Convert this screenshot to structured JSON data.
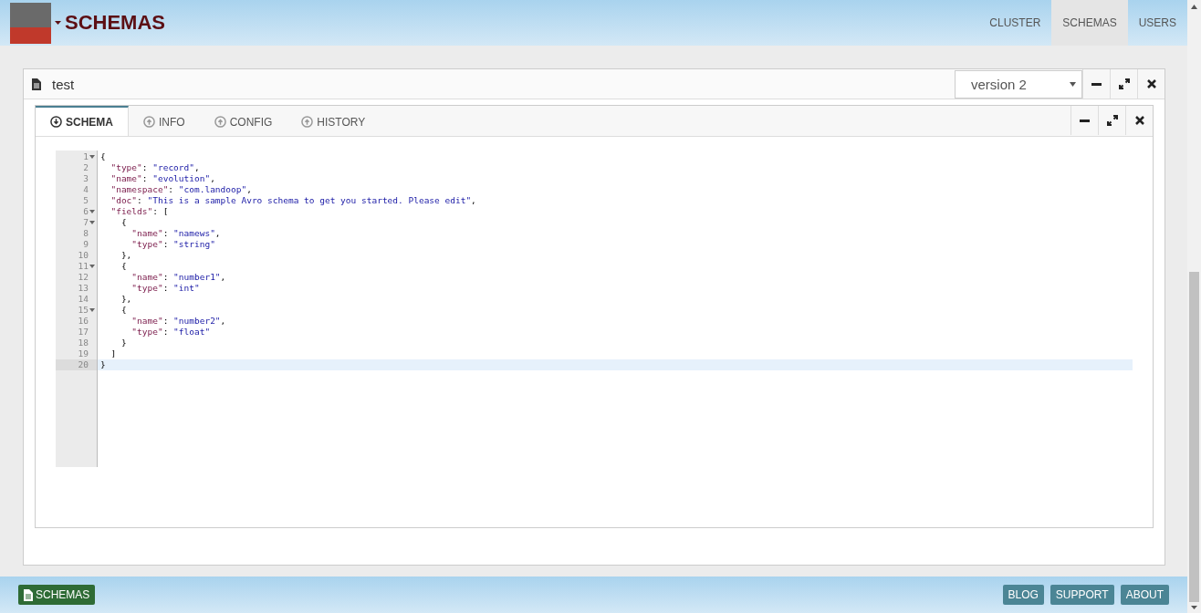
{
  "header": {
    "title": "SCHEMAS",
    "nav": [
      {
        "label": "CLUSTER",
        "selected": false
      },
      {
        "label": "SCHEMAS",
        "selected": true
      },
      {
        "label": "USERS",
        "selected": false
      }
    ]
  },
  "panel": {
    "title": "test",
    "version": "version 2"
  },
  "tabs": [
    {
      "label": "SCHEMA",
      "selected": true
    },
    {
      "label": "INFO",
      "selected": false
    },
    {
      "label": "CONFIG",
      "selected": false
    },
    {
      "label": "HISTORY",
      "selected": false
    }
  ],
  "editor": {
    "lines": [
      {
        "number": "1",
        "foldable": true,
        "selected": false,
        "tokens": [
          {
            "kind": "punct",
            "text": "{"
          }
        ]
      },
      {
        "number": "2",
        "foldable": false,
        "selected": false,
        "tokens": [
          {
            "kind": "key",
            "text": "  \"type\""
          },
          {
            "kind": "punct",
            "text": ": "
          },
          {
            "kind": "string",
            "text": "\"record\""
          },
          {
            "kind": "punct",
            "text": ","
          }
        ]
      },
      {
        "number": "3",
        "foldable": false,
        "selected": false,
        "tokens": [
          {
            "kind": "key",
            "text": "  \"name\""
          },
          {
            "kind": "punct",
            "text": ": "
          },
          {
            "kind": "string",
            "text": "\"evolution\""
          },
          {
            "kind": "punct",
            "text": ","
          }
        ]
      },
      {
        "number": "4",
        "foldable": false,
        "selected": false,
        "tokens": [
          {
            "kind": "key",
            "text": "  \"namespace\""
          },
          {
            "kind": "punct",
            "text": ": "
          },
          {
            "kind": "string",
            "text": "\"com.landoop\""
          },
          {
            "kind": "punct",
            "text": ","
          }
        ]
      },
      {
        "number": "5",
        "foldable": false,
        "selected": false,
        "tokens": [
          {
            "kind": "key",
            "text": "  \"doc\""
          },
          {
            "kind": "punct",
            "text": ": "
          },
          {
            "kind": "string",
            "text": "\"This is a sample Avro schema to get you started. Please edit\""
          },
          {
            "kind": "punct",
            "text": ","
          }
        ]
      },
      {
        "number": "6",
        "foldable": true,
        "selected": false,
        "tokens": [
          {
            "kind": "key",
            "text": "  \"fields\""
          },
          {
            "kind": "punct",
            "text": ": ["
          }
        ]
      },
      {
        "number": "7",
        "foldable": true,
        "selected": false,
        "tokens": [
          {
            "kind": "punct",
            "text": "    {"
          }
        ]
      },
      {
        "number": "8",
        "foldable": false,
        "selected": false,
        "tokens": [
          {
            "kind": "key",
            "text": "      \"name\""
          },
          {
            "kind": "punct",
            "text": ": "
          },
          {
            "kind": "string",
            "text": "\"namews\""
          },
          {
            "kind": "punct",
            "text": ","
          }
        ]
      },
      {
        "number": "9",
        "foldable": false,
        "selected": false,
        "tokens": [
          {
            "kind": "key",
            "text": "      \"type\""
          },
          {
            "kind": "punct",
            "text": ": "
          },
          {
            "kind": "string",
            "text": "\"string\""
          }
        ]
      },
      {
        "number": "10",
        "foldable": false,
        "selected": false,
        "tokens": [
          {
            "kind": "punct",
            "text": "    },"
          }
        ]
      },
      {
        "number": "11",
        "foldable": true,
        "selected": false,
        "tokens": [
          {
            "kind": "punct",
            "text": "    {"
          }
        ]
      },
      {
        "number": "12",
        "foldable": false,
        "selected": false,
        "tokens": [
          {
            "kind": "key",
            "text": "      \"name\""
          },
          {
            "kind": "punct",
            "text": ": "
          },
          {
            "kind": "string",
            "text": "\"number1\""
          },
          {
            "kind": "punct",
            "text": ","
          }
        ]
      },
      {
        "number": "13",
        "foldable": false,
        "selected": false,
        "tokens": [
          {
            "kind": "key",
            "text": "      \"type\""
          },
          {
            "kind": "punct",
            "text": ": "
          },
          {
            "kind": "string",
            "text": "\"int\""
          }
        ]
      },
      {
        "number": "14",
        "foldable": false,
        "selected": false,
        "tokens": [
          {
            "kind": "punct",
            "text": "    },"
          }
        ]
      },
      {
        "number": "15",
        "foldable": true,
        "selected": false,
        "tokens": [
          {
            "kind": "punct",
            "text": "    {"
          }
        ]
      },
      {
        "number": "16",
        "foldable": false,
        "selected": false,
        "tokens": [
          {
            "kind": "key",
            "text": "      \"name\""
          },
          {
            "kind": "punct",
            "text": ": "
          },
          {
            "kind": "string",
            "text": "\"number2\""
          },
          {
            "kind": "punct",
            "text": ","
          }
        ]
      },
      {
        "number": "17",
        "foldable": false,
        "selected": false,
        "tokens": [
          {
            "kind": "key",
            "text": "      \"type\""
          },
          {
            "kind": "punct",
            "text": ": "
          },
          {
            "kind": "string",
            "text": "\"float\""
          }
        ]
      },
      {
        "number": "18",
        "foldable": false,
        "selected": false,
        "tokens": [
          {
            "kind": "punct",
            "text": "    }"
          }
        ]
      },
      {
        "number": "19",
        "foldable": false,
        "selected": false,
        "tokens": [
          {
            "kind": "punct",
            "text": "  ]"
          }
        ]
      },
      {
        "number": "20",
        "foldable": false,
        "selected": true,
        "tokens": [
          {
            "kind": "punct",
            "text": "}"
          }
        ]
      }
    ]
  },
  "footer": {
    "left": "SCHEMAS",
    "links": [
      "BLOG",
      "SUPPORT",
      "ABOUT"
    ]
  }
}
